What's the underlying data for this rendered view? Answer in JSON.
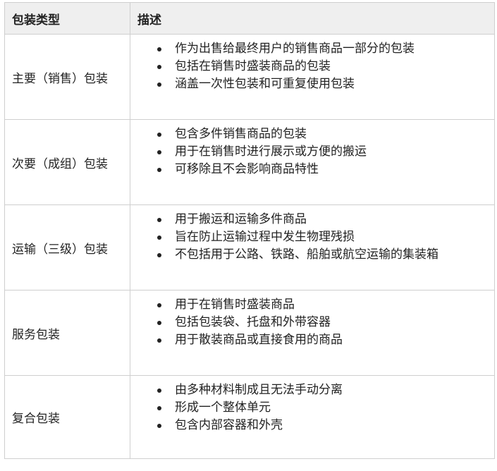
{
  "table": {
    "headers": [
      "包装类型",
      "描述"
    ],
    "rows": [
      {
        "type": "主要（销售）包装",
        "bullets": [
          "作为出售给最终用户的销售商品一部分的包装",
          "包括在销售时盛装商品的包装",
          "涵盖一次性包装和可重复使用包装"
        ]
      },
      {
        "type": "次要（成组）包装",
        "bullets": [
          "包含多件销售商品的包装",
          "用于在销售时进行展示或方便的搬运",
          "可移除且不会影响商品特性"
        ]
      },
      {
        "type": "运输（三级）包装",
        "bullets": [
          "用于搬运和运输多件商品",
          "旨在防止运输过程中发生物理残损",
          "不包括用于公路、铁路、船舶或航空运输的集装箱"
        ]
      },
      {
        "type": "服务包装",
        "bullets": [
          "用于在销售时盛装商品",
          "包括包装袋、托盘和外带容器",
          "用于散装商品或直接食用的商品"
        ]
      },
      {
        "type": "复合包装",
        "bullets": [
          "由多种材料制成且无法手动分离",
          "形成一个整体单元",
          "包含内部容器和外壳"
        ]
      }
    ]
  }
}
